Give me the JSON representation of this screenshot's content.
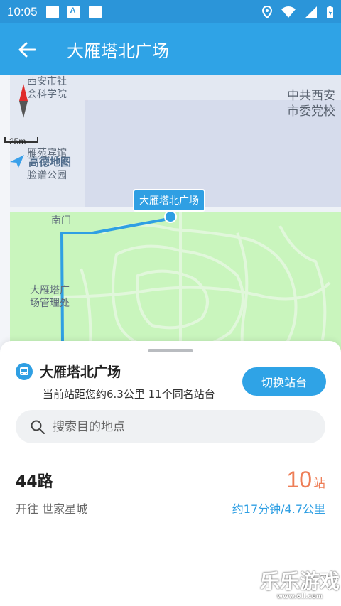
{
  "status_bar": {
    "time": "10:05",
    "notif_letter": "A"
  },
  "header": {
    "title": "大雁塔北广场"
  },
  "map": {
    "scale_label": "25m",
    "provider": "高德地图",
    "labels": {
      "institute": "西安市社\n会科学院",
      "party": "中共西安\n市委党校",
      "hotel": "雁苑宾馆",
      "mask_park": "脸谱公园",
      "south_gate": "南门",
      "management": "大雁塔广\n场管理处"
    },
    "stop_tag": "大雁塔北广场"
  },
  "sheet": {
    "stop_name": "大雁塔北广场",
    "stop_info": "当前站距您约6.3公里   11个同名站台",
    "switch_label": "切换站台",
    "search_placeholder": "搜索目的地点",
    "route": {
      "name": "44路",
      "direction": "开往  世家星城",
      "stops_count": "10",
      "stops_unit": "站",
      "eta": "约17分钟/4.7公里"
    }
  },
  "watermark": {
    "text": "乐乐游戏",
    "url": "www.6ll.com"
  },
  "colors": {
    "primary": "#2fa3e6",
    "accent": "#ee7e57",
    "park": "#c9f5bd",
    "route_line": "#2f9fe3"
  }
}
